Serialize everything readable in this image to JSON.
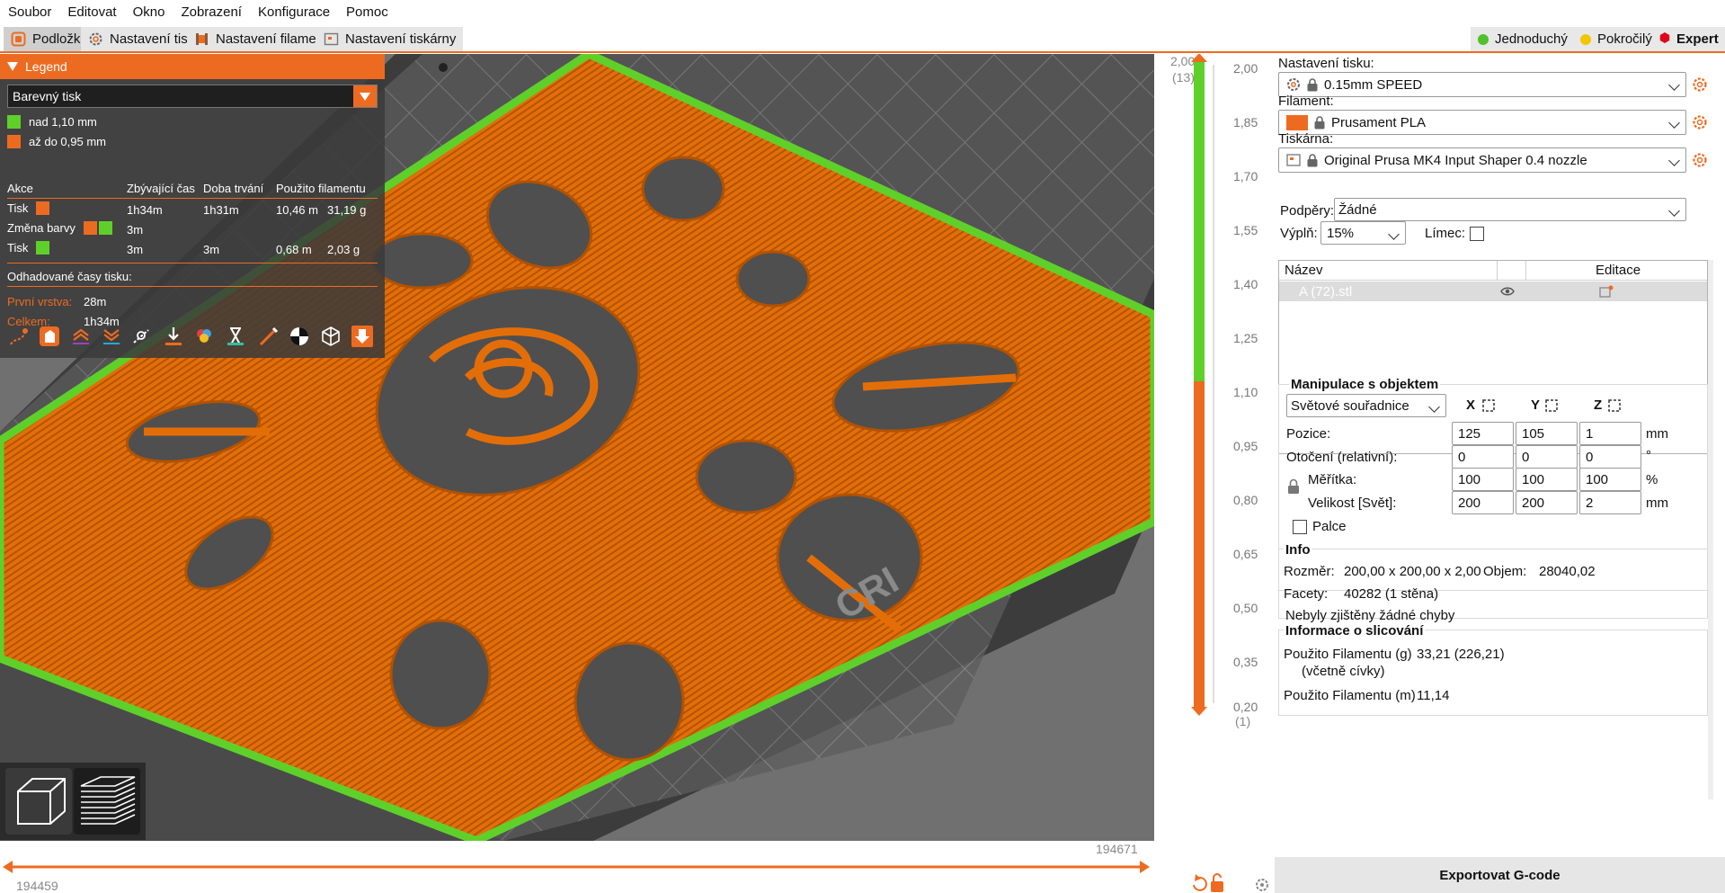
{
  "menu": [
    "Soubor",
    "Editovat",
    "Okno",
    "Zobrazení",
    "Konfigurace",
    "Pomoc"
  ],
  "tabs": {
    "plater": "Podložka",
    "print_settings": "Nastavení tisku",
    "filament_settings": "Nastavení filamentu",
    "printer_settings": "Nastavení tiskárny"
  },
  "modes": {
    "simple": "Jednoduchý",
    "advanced": "Pokročilý",
    "expert": "Expert"
  },
  "colors": {
    "accent": "#ed6b21",
    "green": "#5fd02a",
    "simple_dot": "#4fc12b",
    "advanced_dot": "#f2c600",
    "expert_dot": "#e0001b"
  },
  "legend": {
    "title": "Legend",
    "view_type": "Barevný tisk",
    "ranges": [
      {
        "label": "nad 1,10 mm",
        "color": "#5fd02a"
      },
      {
        "label": "až do 0,95 mm",
        "color": "#ed6b21"
      }
    ],
    "headers": {
      "action": "Akce",
      "remaining": "Zbývající čas",
      "duration": "Doba trvání",
      "used": "Použito filamentu"
    },
    "rows": [
      {
        "action": "Tisk",
        "remaining": "1h34m",
        "duration": "1h31m",
        "length": "10,46 m",
        "weight": "31,19 g"
      },
      {
        "action": "Změna barvy",
        "remaining": "3m",
        "duration": "",
        "length": "",
        "weight": ""
      },
      {
        "action": "Tisk",
        "remaining": "3m",
        "duration": "3m",
        "length": "0,68 m",
        "weight": "2,03 g"
      }
    ],
    "estimated_title": "Odhadované časy tisku:",
    "first_layer_label": "První vrstva:",
    "first_layer_value": "28m",
    "total_label": "Celkem:",
    "total_value": "1h34m"
  },
  "hslider": {
    "left_value": "194459",
    "right_value": "194671"
  },
  "vslider": {
    "top_value": "2,00",
    "top_layer": "(13)",
    "bottom_value": "0,20",
    "bottom_layer": "(1)",
    "ticks": [
      "2,00",
      "1,85",
      "1,70",
      "1,55",
      "1,40",
      "1,25",
      "1,10",
      "0,95",
      "0,80",
      "0,65",
      "0,50",
      "0,35",
      "0,20"
    ]
  },
  "sidebar": {
    "print_label": "Nastavení tisku:",
    "print_value": "0.15mm SPEED",
    "filament_label": "Filament:",
    "filament_value": "Prusament PLA",
    "printer_label": "Tiskárna:",
    "printer_value": "Original Prusa MK4 Input Shaper 0.4 nozzle",
    "supports_label": "Podpěry:",
    "supports_value": "Žádné",
    "infill_label": "Výplň:",
    "infill_value": "15%",
    "brim_label": "Límec:",
    "objects_header_name": "Název",
    "objects_header_edit": "Editace",
    "object_name": "A (72).stl",
    "manip_title": "Manipulace s objektem",
    "coord_system": "Světové souřadnice",
    "axis_x": "X",
    "axis_y": "Y",
    "axis_z": "Z",
    "position_label": "Pozice:",
    "position": [
      "125",
      "105",
      "1"
    ],
    "position_unit": "mm",
    "rotation_label": "Otočení (relativní):",
    "rotation": [
      "0",
      "0",
      "0"
    ],
    "rotation_unit": "°",
    "scale_label": "Měřítka:",
    "scale": [
      "100",
      "100",
      "100"
    ],
    "scale_unit": "%",
    "size_label": "Velikost [Svět]:",
    "size": [
      "200",
      "200",
      "2"
    ],
    "size_unit": "mm",
    "inches_label": "Palce",
    "info_title": "Info",
    "size_info_label": "Rozměr:",
    "size_info_value": "200,00 x 200,00 x 2,00",
    "volume_label": "Objem:",
    "volume_value": "28040,02",
    "facets_label": "Facety:",
    "facets_value": "40282 (1 stěna)",
    "errors_text": "Nebyly zjištěny žádné chyby",
    "slice_title": "Informace o slicování",
    "fil_g_label": "Použito Filamentu (g)",
    "fil_g_sub": "(včetně cívky)",
    "fil_g_value": "33,21 (226,21)",
    "fil_m_label": "Použito Filamentu (m)",
    "fil_m_value": "11,14",
    "export_button": "Exportovat G-code"
  }
}
